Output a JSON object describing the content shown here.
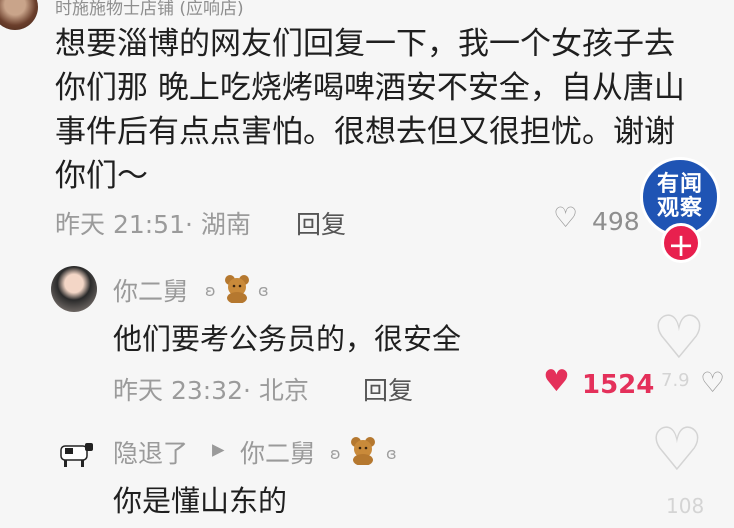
{
  "top_comment": {
    "username_partial": "时施施物士店铺 (应响店)",
    "text": "想要淄博的网友们回复一下，我一个女孩子去你们那 晚上吃烧烤喝啤酒安不安全，自从唐山事件后有点点害怕。很想去但又很担忧。谢谢你们～",
    "time_location": "昨天 21:51· 湖南",
    "reply_label": "回复",
    "likes": "498"
  },
  "watermark": {
    "line1": "有闻",
    "line2": "观察",
    "plus": "+"
  },
  "reply1": {
    "username": "你二舅",
    "text": "他们要考公务员的，很安全",
    "time_location": "昨天 23:32· 北京",
    "reply_label": "回复",
    "likes": "1524",
    "side_count": "7.9"
  },
  "reply2": {
    "username": "隐退了",
    "arrow": "▸",
    "reply_to": "你二舅",
    "text": "你是懂山东的",
    "side_count": "108"
  },
  "colors": {
    "accent_red": "#e4305a",
    "badge_blue": "#1f54b4"
  },
  "icons": [
    "heart-outline-icon",
    "heart-filled-icon",
    "teddy-bear-icon",
    "plus-icon",
    "cow-avatar-icon"
  ]
}
